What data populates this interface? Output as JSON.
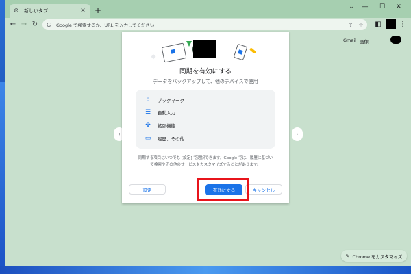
{
  "tab": {
    "title": "新しいタブ"
  },
  "omnibox": {
    "placeholder": "Google で検索するか、URL を入力してください"
  },
  "ntp": {
    "gmail": "Gmail",
    "images": "画像",
    "customize": "Chrome をカスタマイズ"
  },
  "dialog": {
    "title": "同期を有効にする",
    "subtitle": "データをバックアップして、他のデバイスで使用",
    "features": [
      {
        "label": "ブックマーク",
        "icon": "star-icon"
      },
      {
        "label": "自動入力",
        "icon": "clipboard-icon"
      },
      {
        "label": "拡張機能",
        "icon": "puzzle-icon"
      },
      {
        "label": "履歴、その他",
        "icon": "devices-icon"
      }
    ],
    "note_line1": "同期する項目はいつでも [設定] で選択できます。Google では、履歴に基づい",
    "note_line2": "て検索やその他のサービスをカスタマイズすることがあります。",
    "settings_label": "設定",
    "enable_label": "有効にする",
    "cancel_label": "キャンセル"
  },
  "colors": {
    "accent": "#1a73e8",
    "highlight": "#e8141b",
    "background": "#c8e0cd"
  }
}
